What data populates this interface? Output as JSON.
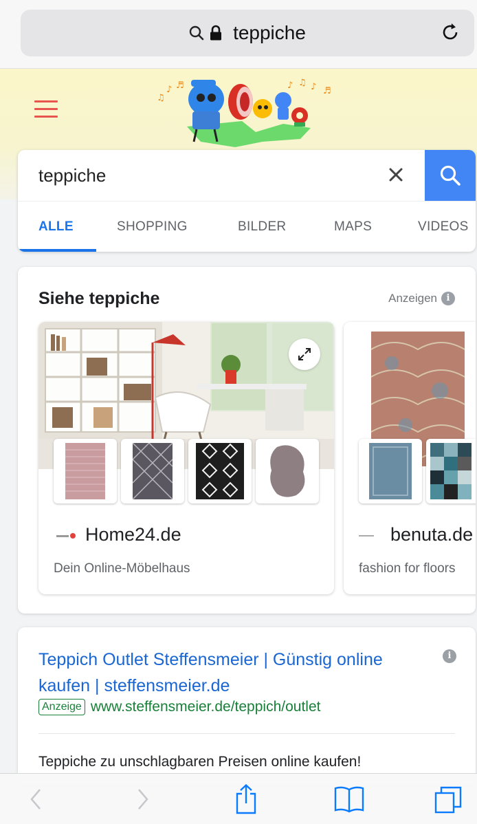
{
  "browser": {
    "url_text": "teppiche",
    "search_icon": "magnifier-icon",
    "lock_icon": "lock-icon",
    "reload_icon": "reload-icon"
  },
  "google": {
    "menu_icon": "hamburger-menu-icon",
    "doodle": "google-doodle-musicians",
    "search": {
      "query": "teppiche",
      "clear_icon": "clear-x-icon",
      "submit_icon": "search-icon"
    },
    "tabs": [
      {
        "label": "ALLE",
        "active": true
      },
      {
        "label": "SHOPPING"
      },
      {
        "label": "BILDER"
      },
      {
        "label": "MAPS"
      },
      {
        "label": "VIDEOS"
      }
    ]
  },
  "shopping": {
    "title": "Siehe teppiche",
    "anzeigen_label": "Anzeigen",
    "merchants": [
      {
        "name": "Home24.de",
        "tagline": "Dein Online-Möbelhaus"
      },
      {
        "name": "benuta.de",
        "tagline": "fashion for floors"
      }
    ]
  },
  "ad": {
    "title": "Teppich Outlet Steffensmeier | Günstig online kaufen | steffensmeier.de",
    "badge": "Anzeige",
    "url": "www.steffensmeier.de/teppich/outlet",
    "description": "Teppiche zu unschlagbaren Preisen online kaufen!"
  },
  "toolbar": {
    "icons": [
      "back-icon",
      "forward-icon",
      "share-icon",
      "bookmarks-icon",
      "tabs-icon"
    ]
  },
  "colors": {
    "google_blue": "#4285f4",
    "link_blue": "#1a66d2",
    "ad_green": "#188038",
    "hamburger_red": "#e8554e",
    "header_yellow": "#fbf6c9"
  }
}
